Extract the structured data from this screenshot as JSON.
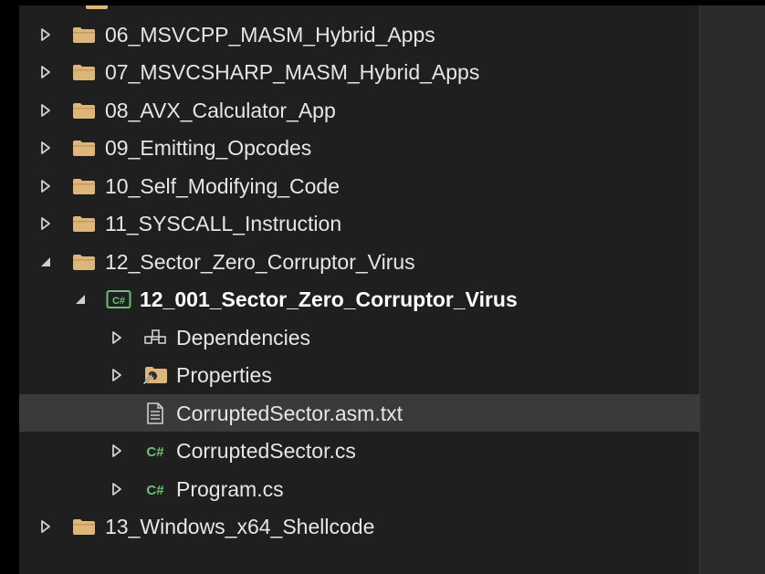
{
  "tree": {
    "items": [
      {
        "label": "06_MSVCPP_MASM_Hybrid_Apps",
        "icon": "folder-icon",
        "expander": "collapsed"
      },
      {
        "label": "07_MSVCSHARP_MASM_Hybrid_Apps",
        "icon": "folder-icon",
        "expander": "collapsed"
      },
      {
        "label": "08_AVX_Calculator_App",
        "icon": "folder-icon",
        "expander": "collapsed"
      },
      {
        "label": "09_Emitting_Opcodes",
        "icon": "folder-icon",
        "expander": "collapsed"
      },
      {
        "label": "10_Self_Modifying_Code",
        "icon": "folder-icon",
        "expander": "collapsed"
      },
      {
        "label": "11_SYSCALL_Instruction",
        "icon": "folder-icon",
        "expander": "collapsed"
      },
      {
        "label": "12_Sector_Zero_Corruptor_Virus",
        "icon": "folder-icon",
        "expander": "expanded"
      },
      {
        "label": "12_001_Sector_Zero_Corruptor_Virus",
        "icon": "csharp-project-icon",
        "expander": "expanded"
      },
      {
        "label": "Dependencies",
        "icon": "dependencies-icon",
        "expander": "collapsed"
      },
      {
        "label": "Properties",
        "icon": "properties-folder-icon",
        "expander": "collapsed"
      },
      {
        "label": "CorruptedSector.asm.txt",
        "icon": "text-file-icon",
        "expander": "none"
      },
      {
        "label": "CorruptedSector.cs",
        "icon": "csharp-file-icon",
        "expander": "collapsed"
      },
      {
        "label": "Program.cs",
        "icon": "csharp-file-icon",
        "expander": "collapsed"
      },
      {
        "label": "13_Windows_x64_Shellcode",
        "icon": "folder-icon",
        "expander": "collapsed"
      }
    ],
    "selected_item": "CorruptedSector.asm.txt"
  },
  "colors": {
    "panel_background": "#1f1f1f",
    "selected_row": "#3a3a3a",
    "folder": "#dcb67a",
    "csharp": "#6fbf73",
    "text": "#e6e6e6"
  }
}
